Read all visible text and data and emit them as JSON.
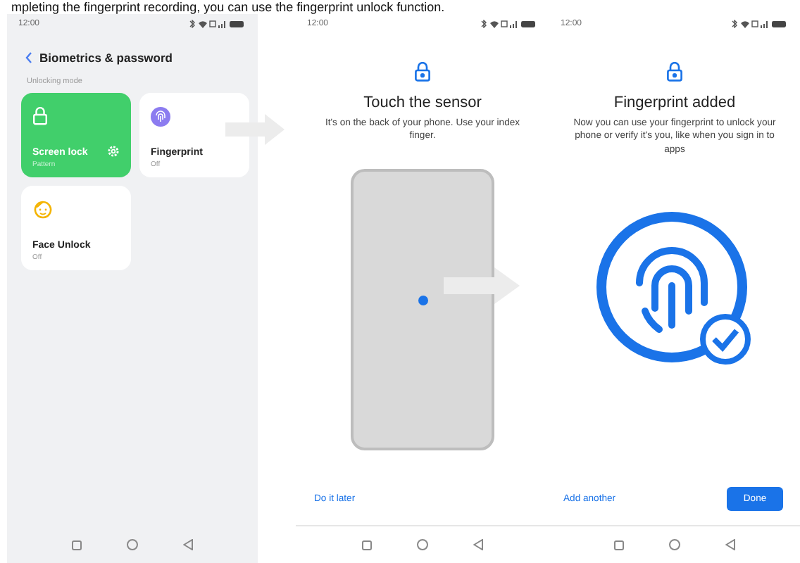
{
  "caption": "mpleting the fingerprint recording, you can use the fingerprint unlock function.",
  "settings_screen": {
    "time": "12:00",
    "title": "Biometrics & password",
    "section": "Unlocking mode",
    "cards": [
      {
        "kind": "lock",
        "title": "Screen lock",
        "status": "Pattern",
        "selected": true
      },
      {
        "kind": "fingerprint",
        "title": "Fingerprint",
        "status": "Off",
        "selected": false
      },
      {
        "kind": "face",
        "title": "Face Unlock",
        "status": "Off",
        "selected": false
      }
    ]
  },
  "sensor_screen": {
    "time": "12:00",
    "title": "Touch the sensor",
    "description": "It's on the back of your phone. Use your index finger.",
    "skip_link": "Do it later"
  },
  "added_screen": {
    "time": "12:00",
    "title": "Fingerprint added",
    "description": "Now you can use your fingerprint to unlock your phone or verify it's you, like when you sign in to apps",
    "add_link": "Add another",
    "done_button": "Done"
  }
}
